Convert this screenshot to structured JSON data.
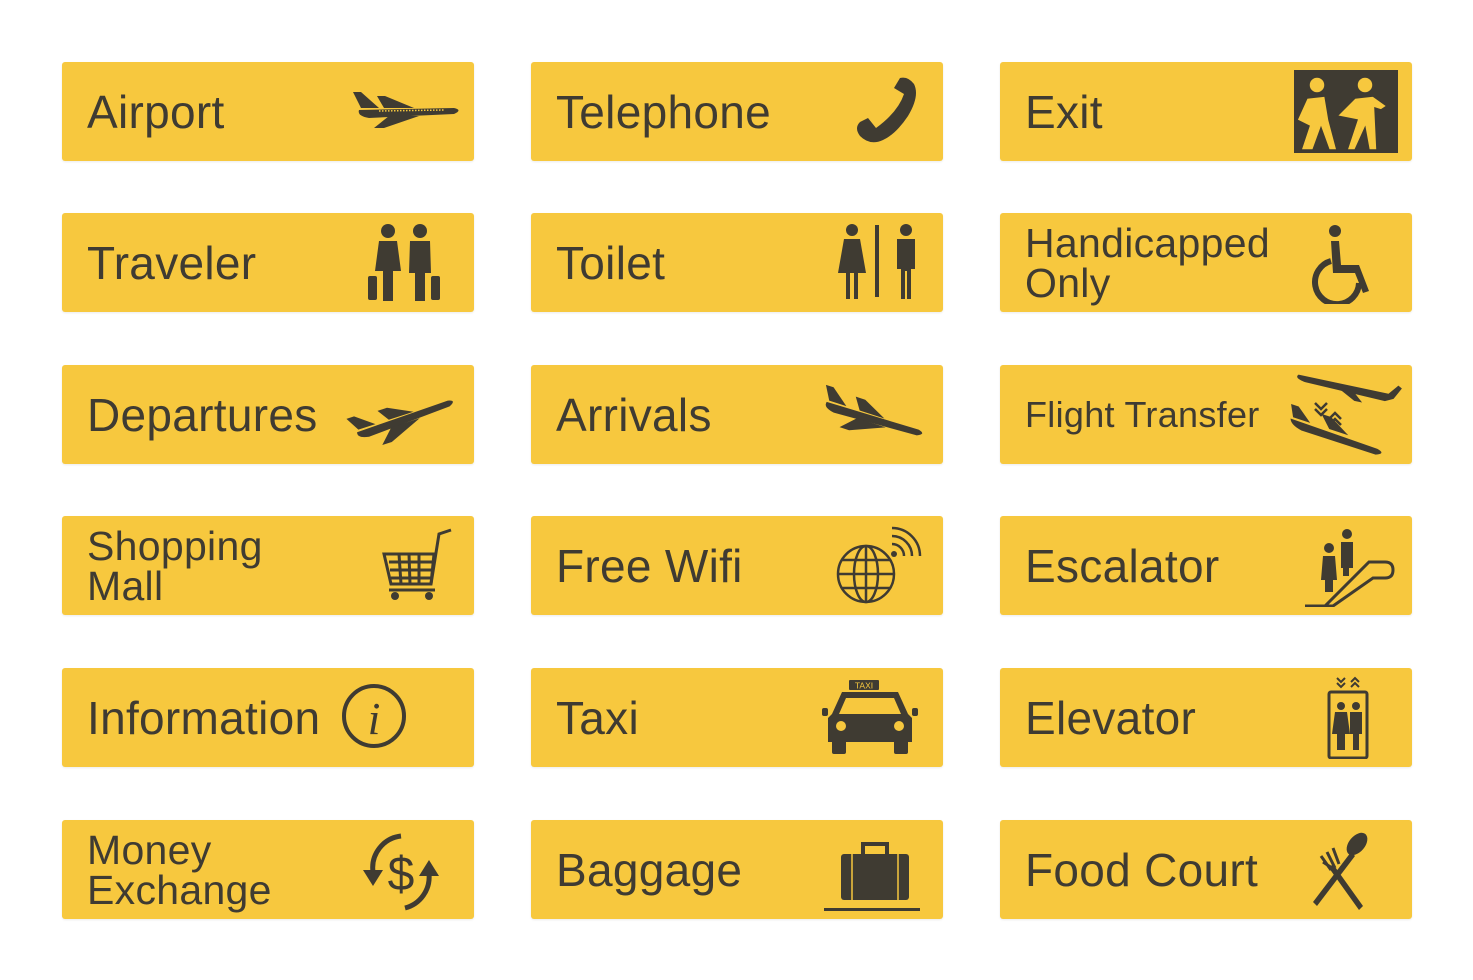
{
  "colors": {
    "sign_background": "#f7c83e",
    "foreground": "#3f3b32",
    "page_background": "#ffffff"
  },
  "signs": [
    {
      "label": "Airport",
      "icon": "airplane-icon"
    },
    {
      "label": "Telephone",
      "icon": "telephone-icon"
    },
    {
      "label": "Exit",
      "icon": "exit-icon"
    },
    {
      "label": "Traveler",
      "icon": "travelers-icon"
    },
    {
      "label": "Toilet",
      "icon": "toilet-icon"
    },
    {
      "label": "Handicapped Only",
      "icon": "wheelchair-icon"
    },
    {
      "label": "Departures",
      "icon": "departures-icon"
    },
    {
      "label": "Arrivals",
      "icon": "arrivals-icon"
    },
    {
      "label": "Flight Transfer",
      "icon": "flight-transfer-icon"
    },
    {
      "label": "Shopping Mall",
      "icon": "shopping-cart-icon"
    },
    {
      "label": "Free Wifi",
      "icon": "wifi-globe-icon"
    },
    {
      "label": "Escalator",
      "icon": "escalator-icon"
    },
    {
      "label": "Information",
      "icon": "information-icon"
    },
    {
      "label": "Taxi",
      "icon": "taxi-icon",
      "icon_text": "TAXI"
    },
    {
      "label": "Elevator",
      "icon": "elevator-icon"
    },
    {
      "label": "Money Exchange",
      "icon": "money-exchange-icon"
    },
    {
      "label": "Baggage",
      "icon": "baggage-icon"
    },
    {
      "label": "Food Court",
      "icon": "food-court-icon"
    }
  ]
}
